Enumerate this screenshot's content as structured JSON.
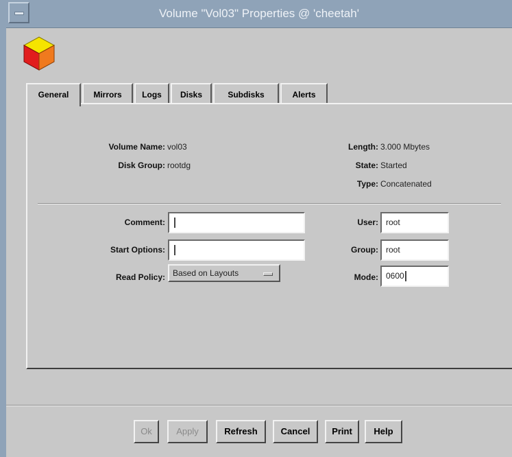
{
  "window": {
    "title": "Volume \"Vol03\" Properties @ 'cheetah'"
  },
  "icons": {
    "window_menu": "window-menu-icon",
    "app": "volume-cube-icon",
    "option_menu": "option-menu-indicator-icon"
  },
  "colors": {
    "titlebar": "#8fa3b8",
    "cube_top": "#f5e400",
    "cube_left": "#e11d1d",
    "cube_right": "#f07a1e"
  },
  "tabs": [
    {
      "label": "General",
      "active": true
    },
    {
      "label": "Mirrors"
    },
    {
      "label": "Logs"
    },
    {
      "label": "Disks"
    },
    {
      "label": "Subdisks"
    },
    {
      "label": "Alerts"
    }
  ],
  "general": {
    "volume_name_label": "Volume Name:",
    "volume_name": "vol03",
    "disk_group_label": "Disk Group:",
    "disk_group": "rootdg",
    "length_label": "Length:",
    "length": "3.000 Mbytes",
    "state_label": "State:",
    "state": "Started",
    "type_label": "Type:",
    "type": "Concatenated",
    "comment_label": "Comment:",
    "comment": "",
    "start_options_label": "Start Options:",
    "start_options": "",
    "read_policy_label": "Read Policy:",
    "read_policy": "Based on Layouts",
    "user_label": "User:",
    "user": "root",
    "group_label": "Group:",
    "group": "root",
    "mode_label": "Mode:",
    "mode": "0600"
  },
  "buttons": {
    "ok": "Ok",
    "apply": "Apply",
    "refresh": "Refresh",
    "cancel": "Cancel",
    "print": "Print",
    "help": "Help"
  }
}
